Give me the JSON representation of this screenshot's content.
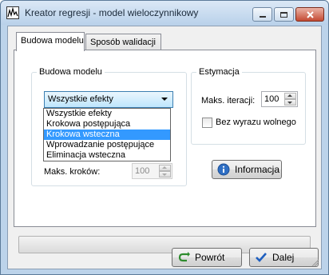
{
  "window": {
    "title": "Kreator regresji - model wieloczynnikowy"
  },
  "tabs": [
    {
      "label": "Budowa modelu",
      "active": true
    },
    {
      "label": "Sposób walidacji",
      "active": false
    }
  ],
  "model_group": {
    "label": "Budowa modelu",
    "combo_value": "Wszystkie efekty",
    "options": [
      "Wszystkie efekty",
      "Krokowa postępująca",
      "Krokowa wsteczna",
      "Wprowadzanie postępujące",
      "Eliminacja wsteczna"
    ],
    "highlighted_option": "Krokowa wsteczna",
    "max_steps_label": "Maks. kroków:",
    "max_steps_value": "100"
  },
  "estimation_group": {
    "label": "Estymacja",
    "max_iter_label": "Maks. iteracji:",
    "max_iter_value": "100",
    "no_intercept_label": "Bez wyrazu wolnego",
    "no_intercept_checked": false
  },
  "info_button": {
    "label": "Informacja"
  },
  "progress": {
    "value": 0
  },
  "footer": {
    "back_label": "Powrót",
    "next_label": "Dalej"
  },
  "colors": {
    "selection": "#3399ff",
    "title_bar": "#bcd3ea",
    "close_button": "#c44a33"
  },
  "icons": {
    "app": "chart-icon",
    "minimize": "minimize-icon",
    "maximize": "maximize-icon",
    "close": "close-icon",
    "info": "info-icon",
    "back": "arrow-back-icon",
    "next": "checkmark-icon"
  }
}
